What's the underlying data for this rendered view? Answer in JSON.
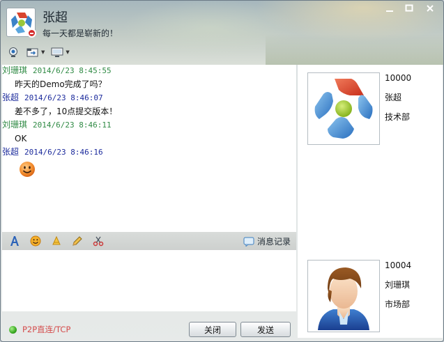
{
  "header": {
    "name": "张超",
    "signature": "每一天都是崭新的！"
  },
  "window_controls": {
    "minimize": "▁",
    "maximize": "□",
    "close": "✕"
  },
  "toolbar": {
    "icons": [
      "webcam-icon",
      "file-transfer-icon",
      "screen-share-icon"
    ]
  },
  "messages": [
    {
      "sender": "刘珊琪",
      "time": "2014/6/23 8:45:55",
      "text": "昨天的Demo完成了吗？",
      "color": "#2f8a44"
    },
    {
      "sender": "张超",
      "time": "2014/6/23 8:46:07",
      "text": "差不多了，10点提交版本！",
      "color": "#1b2a9c"
    },
    {
      "sender": "刘珊琪",
      "time": "2014/6/23 8:46:11",
      "text": "OK",
      "color": "#2f8a44"
    },
    {
      "sender": "张超",
      "time": "2014/6/23 8:46:16",
      "text": "",
      "emoji": "smiley-icon",
      "color": "#1b2a9c"
    }
  ],
  "input_toolbar": {
    "icons": [
      "font-icon",
      "emoji-icon",
      "shake-icon",
      "pencil-icon",
      "scissors-icon"
    ],
    "history_label": "消息记录"
  },
  "status": {
    "connection_label": "P2P直连/TCP",
    "connection_color": "#d44c4c"
  },
  "buttons": {
    "close_label": "关闭",
    "send_label": "发送"
  },
  "contacts": [
    {
      "id": "10000",
      "name": "张超",
      "department": "技术部"
    },
    {
      "id": "10004",
      "name": "刘珊琪",
      "department": "市场部"
    }
  ]
}
